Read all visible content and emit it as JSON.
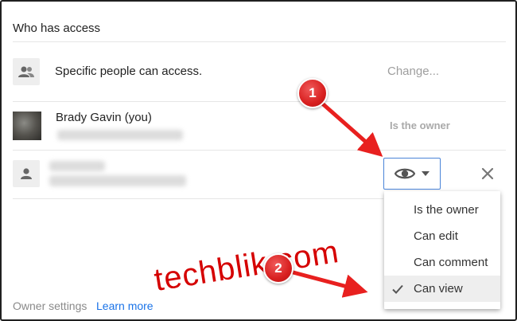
{
  "dialog": {
    "title": "Who has access"
  },
  "access_row": {
    "icon": "people-icon",
    "text": "Specific people can access.",
    "change_label": "Change..."
  },
  "owner_row": {
    "name": "Brady Gavin (you)",
    "role": "Is the owner"
  },
  "shared_user_row": {
    "icon": "person-icon",
    "permission_icon": "eye-icon",
    "remove_icon": "close-icon"
  },
  "permission_menu": {
    "items": [
      {
        "label": "Is the owner",
        "checked": false
      },
      {
        "label": "Can edit",
        "checked": false
      },
      {
        "label": "Can comment",
        "checked": false
      },
      {
        "label": "Can view",
        "checked": true
      }
    ]
  },
  "footer": {
    "owner_settings": "Owner settings",
    "learn_more": "Learn more"
  },
  "annotations": {
    "badge_1": "1",
    "badge_2": "2",
    "arrow_color": "#e8201f",
    "watermark": "techblik.com"
  },
  "colors": {
    "accent_blue": "#1a73e8",
    "annotation_red": "#d81f1f"
  }
}
